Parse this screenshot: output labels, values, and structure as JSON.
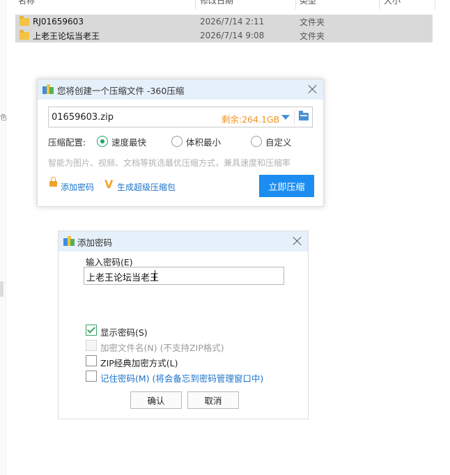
{
  "explorer": {
    "columns": {
      "name": "名称",
      "date": "修改日期",
      "type": "类型",
      "size": "大小"
    },
    "side_glyph": "色",
    "rows": [
      {
        "name": "RJ01659603",
        "date": "2026/7/14 2:11",
        "type": "文件夹"
      },
      {
        "name": "上老王论坛当老王",
        "date": "2026/7/14 9:08",
        "type": "文件夹"
      }
    ]
  },
  "compress_dialog": {
    "title": "您将创建一个压缩文件 -360压缩",
    "filename": "01659603.zip",
    "remaining": "剩余:264.1GB",
    "config_label": "压缩配置:",
    "options": [
      "速度最快",
      "体积最小",
      "自定义"
    ],
    "selected_option": "速度最快",
    "hint": "智能为图片、视频、文档等挑选最优压缩方式，兼具速度和压缩率",
    "add_password_link": "添加密码",
    "super_package_link": "生成超级压缩包",
    "compress_button": "立即压缩",
    "accent_color": "#1c8cf0",
    "remain_color": "#f0931d"
  },
  "password_dialog": {
    "title": "添加密码",
    "input_label": "输入密码(E)",
    "password_value": "上老王论坛当老王",
    "checkboxes": {
      "show_password": {
        "label": "显示密码(S)",
        "checked": true
      },
      "encrypt_names": {
        "label": "加密文件名(N) (不支持ZIP格式)",
        "checked": false,
        "disabled": true
      },
      "zip_classic": {
        "label": "ZIP经典加密方式(L)",
        "checked": false
      },
      "remember": {
        "label": "记住密码(M) (将会备忘到密码管理窗口中)",
        "checked": false
      }
    },
    "ok_button": "确认",
    "cancel_button": "取消"
  }
}
